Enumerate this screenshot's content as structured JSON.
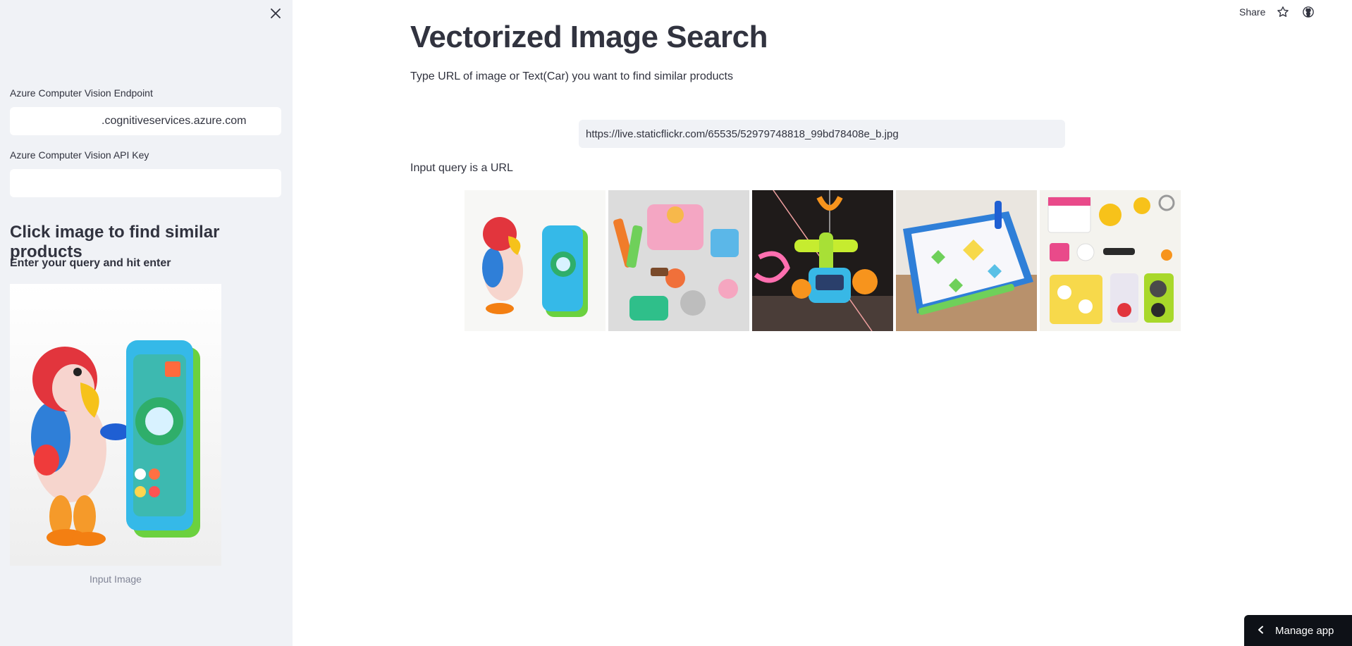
{
  "sidebar": {
    "endpoint_label": "Azure Computer Vision Endpoint",
    "endpoint_value": ".cognitiveservices.azure.com",
    "api_key_label": "Azure Computer Vision API Key",
    "api_key_value": "",
    "heading": "Click image to find similar products",
    "subheading": "Enter your query and hit enter",
    "image_caption": "Input Image",
    "close_icon": "close-icon"
  },
  "header": {
    "share_label": "Share",
    "star_icon": "star-icon",
    "github_icon": "github-icon"
  },
  "main": {
    "title": "Vectorized Image Search",
    "description": "Type URL of image or Text(Car) you want to find similar products",
    "query_value": "https://live.staticflickr.com/65535/52979748818_99bd78408e_b.jpg",
    "query_message": "Input query is a URL",
    "results": [
      {
        "name": "parrot-toy"
      },
      {
        "name": "tools-toy-set"
      },
      {
        "name": "hanging-robot-toy"
      },
      {
        "name": "drawing-board-toy"
      },
      {
        "name": "kitchen-toy-set"
      }
    ]
  },
  "footer": {
    "manage_label": "Manage app",
    "chevron_icon": "chevron-left-icon"
  },
  "colors": {
    "sidebar_bg": "#f0f2f6",
    "text": "#31333f",
    "muted": "#808495",
    "manage_bg": "#0e1117"
  }
}
